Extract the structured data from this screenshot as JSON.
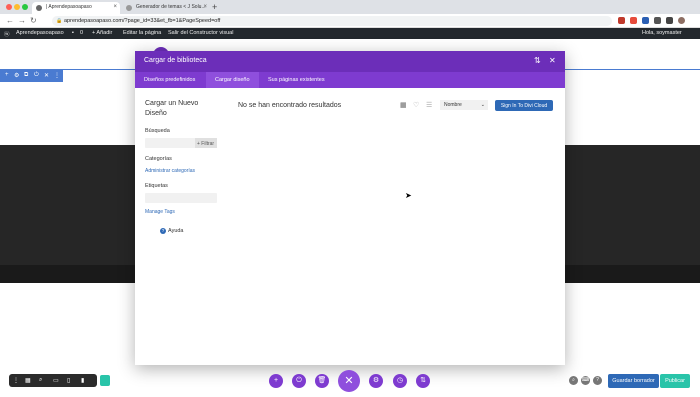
{
  "browser": {
    "tabs": [
      {
        "label": "| Aprendepasoapaso"
      },
      {
        "label": "Generador de temas < J Solu..."
      }
    ],
    "new_tab": "+",
    "url": "aprendepasoapaso.com/?page_id=33&et_fb=1&PageSpeed=off",
    "nav": {
      "back": "←",
      "forward": "→",
      "reload": "↻"
    }
  },
  "wp_admin": {
    "site": "Aprendepasoapaso",
    "comments": "0",
    "add": "+ Añadir",
    "edit_page": "Editar la página",
    "exit_builder": "Salir del Constructor visual",
    "greeting": "Hola, soymaster"
  },
  "modal": {
    "title": "Cargar de biblioteca",
    "tabs": [
      {
        "label": "Diseños predefinidos"
      },
      {
        "label": "Cargar diseño"
      },
      {
        "label": "Sus páginas existentes"
      }
    ],
    "left": {
      "heading": "Cargar un Nuevo Diseño",
      "search_label": "Búsqueda",
      "filter_label": "+ Filtrar",
      "categories_label": "Categorías",
      "manage_categories": "Administrar categorías",
      "tags_label": "Etiquetas",
      "manage_tags": "Manage Tags",
      "help": "Ayuda"
    },
    "main": {
      "no_results": "No se han encontrado resultados",
      "sort_value": "Nombre",
      "cloud_button": "Sign In To Divi Cloud"
    }
  },
  "bottom": {
    "save": "Guardar borrador",
    "publish": "Publicar"
  },
  "colors": {
    "header": "#6c2eb9",
    "tabs": "#7e3bd0",
    "accent_blue": "#2e69b6",
    "accent_green": "#29c4a9"
  }
}
